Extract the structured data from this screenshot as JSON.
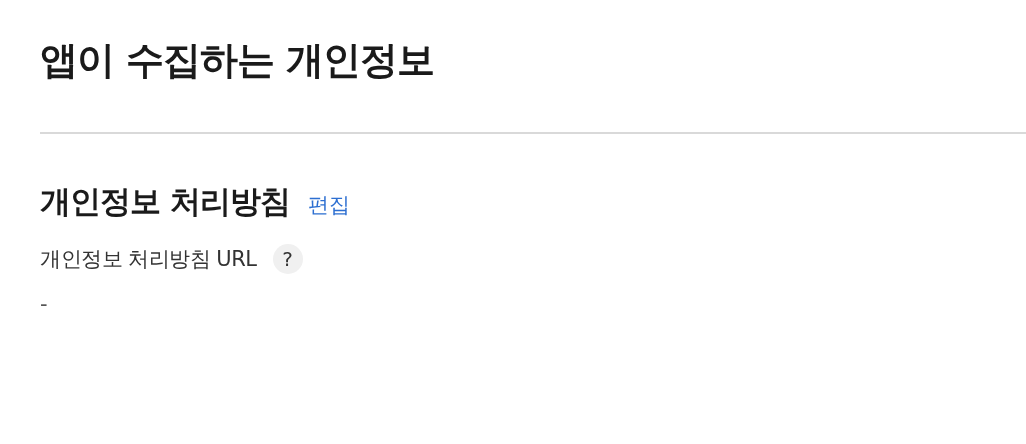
{
  "page_title": "앱이 수집하는 개인정보",
  "section": {
    "title": "개인정보 처리방침",
    "edit_link": "편집",
    "field": {
      "label": "개인정보 처리방침 URL",
      "help": "?",
      "value": "-"
    }
  }
}
